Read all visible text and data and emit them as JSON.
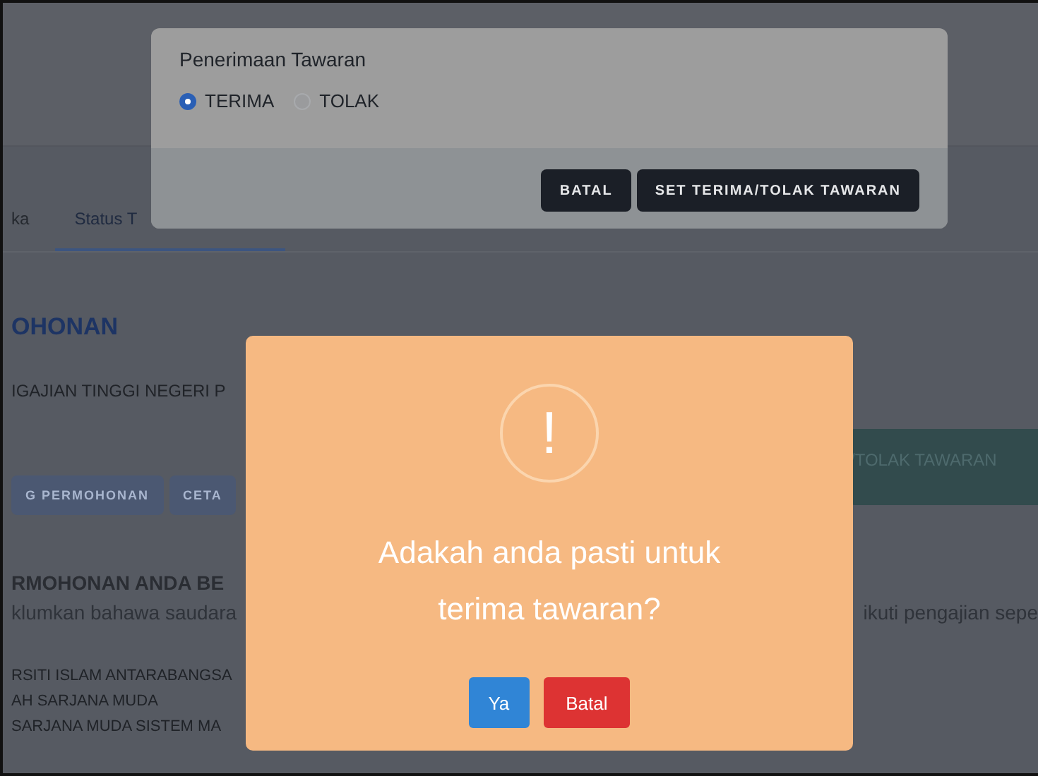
{
  "background": {
    "tabs": [
      {
        "label": "ka",
        "selected": false
      },
      {
        "label": "Status T",
        "selected": true
      }
    ],
    "section_title": "OHONAN",
    "institution": "IGAJIAN TINGGI NEGERI P",
    "offer_button": "/TOLAK TAWARAN",
    "buttons": [
      "G PERMOHONAN",
      "CETA"
    ],
    "notice_title": "RMOHONAN ANDA BE",
    "notice_text": "klumkan bahawa saudara",
    "notice_text_right": "ikuti pengajian sepe",
    "details": [
      "RSITI ISLAM ANTARABANGSA",
      "AH SARJANA MUDA",
      "SARJANA MUDA SISTEM MA"
    ]
  },
  "offer_dialog": {
    "title": "Penerimaan Tawaran",
    "options": [
      {
        "label": "TERIMA",
        "selected": true
      },
      {
        "label": "TOLAK",
        "selected": false
      }
    ],
    "buttons": [
      "BATAL",
      "SET TERIMA/TOLAK TAWARAN"
    ]
  },
  "confirm_dialog": {
    "icon": "!",
    "message": "Adakah anda pasti untuk terima tawaran?",
    "buttons": [
      {
        "label": "Ya",
        "kind": "confirm"
      },
      {
        "label": "Batal",
        "kind": "cancel"
      }
    ]
  }
}
